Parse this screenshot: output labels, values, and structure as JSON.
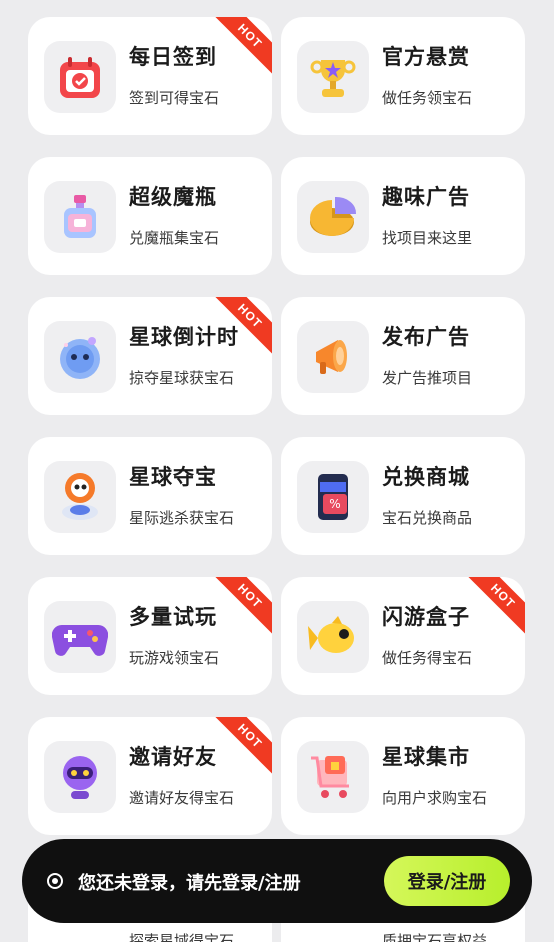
{
  "cards": [
    {
      "title": "每日签到",
      "sub": "签到可得宝石",
      "hot": "HOT",
      "icon": "calendar-check-icon"
    },
    {
      "title": "官方悬赏",
      "sub": "做任务领宝石",
      "hot": "",
      "icon": "trophy-icon"
    },
    {
      "title": "超级魔瓶",
      "sub": "兑魔瓶集宝石",
      "hot": "",
      "icon": "perfume-bottle-icon"
    },
    {
      "title": "趣味广告",
      "sub": "找项目来这里",
      "hot": "",
      "icon": "pie-chart-icon"
    },
    {
      "title": "星球倒计时",
      "sub": "掠夺星球获宝石",
      "hot": "HOT",
      "icon": "robot-planet-icon"
    },
    {
      "title": "发布广告",
      "sub": "发广告推项目",
      "hot": "",
      "icon": "megaphone-icon"
    },
    {
      "title": "星球夺宝",
      "sub": "星际逃杀获宝石",
      "hot": "",
      "icon": "astronaut-icon"
    },
    {
      "title": "兑换商城",
      "sub": "宝石兑换商品",
      "hot": "",
      "icon": "store-phone-icon"
    },
    {
      "title": "多量试玩",
      "sub": "玩游戏领宝石",
      "hot": "HOT",
      "icon": "gamepad-icon"
    },
    {
      "title": "闪游盒子",
      "sub": "做任务得宝石",
      "hot": "HOT",
      "icon": "fish-icon"
    },
    {
      "title": "邀请好友",
      "sub": "邀请好友得宝石",
      "hot": "HOT",
      "icon": "robot-head-icon"
    },
    {
      "title": "星球集市",
      "sub": "向用户求购宝石",
      "hot": "",
      "icon": "shopping-cart-icon"
    }
  ],
  "peek": {
    "left": "探索星域得宝石",
    "right": "质押宝石享权益"
  },
  "login_bar": {
    "message": "您还未登录，请先登录/注册",
    "button": "登录/注册"
  }
}
